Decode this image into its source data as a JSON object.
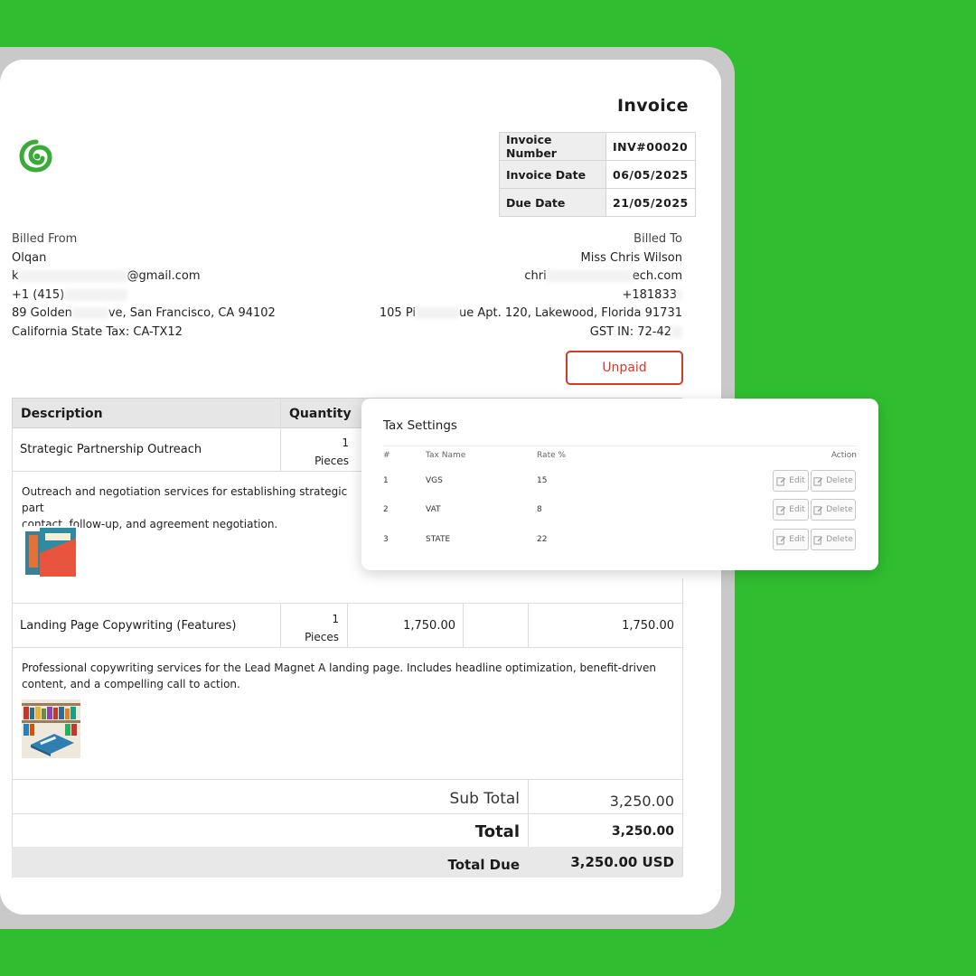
{
  "invoice": {
    "title": "Invoice",
    "meta": [
      {
        "label": "Invoice Number",
        "value": "INV#00020"
      },
      {
        "label": "Invoice Date",
        "value": "06/05/2025"
      },
      {
        "label": "Due Date",
        "value": "21/05/2025"
      }
    ],
    "billed_from": {
      "caption": "Billed From",
      "name": "Olqan",
      "email_start": "k",
      "email_end": "@gmail.com",
      "phone": "+1 (415)",
      "address_start": "89 Golden",
      "address_end": "ve, San Francisco, CA 94102",
      "tax": "California State Tax: CA-TX12"
    },
    "billed_to": {
      "caption": "Billed To",
      "name": "Miss Chris Wilson",
      "email_start": "chri",
      "email_end": "ech.com",
      "phone": "+181833",
      "address_start": "105 Pi",
      "address_end": "ue Apt. 120, Lakewood, Florida 91731",
      "tax": "GST IN: 72-42"
    },
    "status": "Unpaid",
    "columns": {
      "description": "Description",
      "quantity": "Quantity"
    },
    "items": [
      {
        "name": "Strategic Partnership Outreach",
        "qty": "1",
        "unit": "Pieces",
        "description_line1": "Outreach and negotiation services for establishing strategic part",
        "description_line2": "contact, follow-up, and agreement negotiation."
      },
      {
        "name": "Landing Page Copywriting (Features)",
        "qty": "1",
        "unit": "Pieces",
        "price": "1,750.00",
        "amount": "1,750.00",
        "description_line1": "Professional copywriting services for the Lead Magnet A landing page. Includes headline optimization, benefit-driven",
        "description_line2": "content, and a compelling call to action."
      }
    ],
    "totals": {
      "subtotal_label": "Sub Total",
      "subtotal": "3,250.00",
      "total_label": "Total",
      "total": "3,250.00",
      "due_label": "Total Due",
      "due": "3,250.00 USD"
    }
  },
  "tax_modal": {
    "title": "Tax Settings",
    "headers": {
      "index": "#",
      "name": "Tax Name",
      "rate": "Rate %",
      "action": "Action"
    },
    "rows": [
      {
        "index": "1",
        "name": "VGS",
        "rate": "15"
      },
      {
        "index": "2",
        "name": "VAT",
        "rate": "8"
      },
      {
        "index": "3",
        "name": "STATE",
        "rate": "22"
      }
    ],
    "edit_label": "Edit",
    "delete_label": "Delete"
  },
  "colors": {
    "background": "#30be30",
    "logo": "#3aab37",
    "unpaid": "#d33a2c"
  }
}
